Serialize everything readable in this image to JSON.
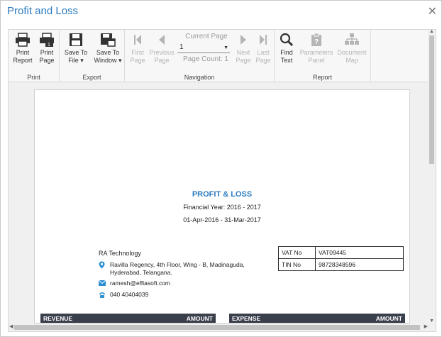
{
  "window": {
    "title": "Profit and Loss"
  },
  "ribbon": {
    "print": {
      "label": "Print",
      "print_report": "Print\nReport",
      "print_page": "Print\nPage"
    },
    "export": {
      "label": "Export",
      "save_to_file": "Save To\nFile ▾",
      "save_to_window": "Save To\nWindow ▾"
    },
    "navigation": {
      "label": "Navigation",
      "first_page": "First\nPage",
      "previous_page": "Previous\nPage",
      "current_page_label": "Current Page",
      "current_page_value": "1",
      "page_count": "Page Count: 1",
      "next_page": "Next\nPage",
      "last_page": "Last\nPage"
    },
    "report": {
      "label": "Report",
      "find_text": "Find\nText",
      "parameters_panel": "Parameters\nPanel",
      "document_map": "Document\nMap"
    }
  },
  "report": {
    "title": "PROFIT & LOSS",
    "financial_year": "Financial Year: 2016 - 2017",
    "date_range": "01-Apr-2016 - 31-Mar-2017",
    "company": {
      "name": "RA Technology",
      "address_line1": "Ravilla Regency, 4th Floor, Wing - B, Madinaguda,",
      "address_line2": "Hyderabad, Telangana.",
      "email": "ramesh@effiasoft.com",
      "phone": "040 40404039"
    },
    "tax": [
      {
        "key": "VAT No",
        "value": "VAT09445"
      },
      {
        "key": "TIN No",
        "value": "98728348596"
      }
    ],
    "revenue_header": {
      "name": "REVENUE",
      "amount": "AMOUNT"
    },
    "expense_header": {
      "name": "EXPENSE",
      "amount": "AMOUNT"
    }
  },
  "colors": {
    "accent": "#2b7bbf",
    "header_bg": "#3a3f4c"
  },
  "icons": [
    "printer-icon",
    "print-page-icon",
    "save-icon",
    "save-window-icon",
    "first-page-icon",
    "previous-page-icon",
    "next-page-icon",
    "last-page-icon",
    "search-icon",
    "parameters-icon",
    "document-map-icon",
    "location-icon",
    "email-icon",
    "phone-icon",
    "close-icon"
  ]
}
